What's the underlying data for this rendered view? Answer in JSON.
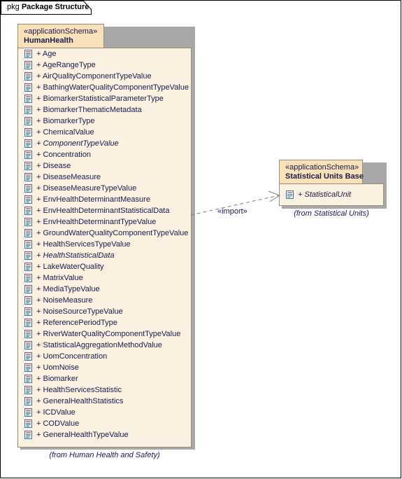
{
  "diagram": {
    "frame_keyword": "pkg",
    "frame_title": "Package Structure"
  },
  "packages": [
    {
      "id": "human-health",
      "stereotype": "«applicationSchema»",
      "name": "HumanHealth",
      "caption": "(from Human Health and Safety)",
      "classes": [
        {
          "visibility": "+",
          "name": "Age",
          "abstract": false
        },
        {
          "visibility": "+",
          "name": "AgeRangeType",
          "abstract": false
        },
        {
          "visibility": "+",
          "name": "AirQualityComponentTypeValue",
          "abstract": false
        },
        {
          "visibility": "+",
          "name": "BathingWaterQualityComponentTypeValue",
          "abstract": false
        },
        {
          "visibility": "+",
          "name": "BiomarkerStatisticalParameterType",
          "abstract": false
        },
        {
          "visibility": "+",
          "name": "BiomarkerThematicMetadata",
          "abstract": false
        },
        {
          "visibility": "+",
          "name": "BiomarkerType",
          "abstract": false
        },
        {
          "visibility": "+",
          "name": "ChemicalValue",
          "abstract": false
        },
        {
          "visibility": "+",
          "name": "ComponentTypeValue",
          "abstract": true
        },
        {
          "visibility": "+",
          "name": "Concentration",
          "abstract": false
        },
        {
          "visibility": "+",
          "name": "Disease",
          "abstract": false
        },
        {
          "visibility": "+",
          "name": "DiseaseMeasure",
          "abstract": false
        },
        {
          "visibility": "+",
          "name": "DiseaseMeasureTypeValue",
          "abstract": false
        },
        {
          "visibility": "+",
          "name": "EnvHealthDeterminantMeasure",
          "abstract": false
        },
        {
          "visibility": "+",
          "name": "EnvHealthDeterminantStatisticalData",
          "abstract": false
        },
        {
          "visibility": "+",
          "name": "EnvHealthDeterminantTypeValue",
          "abstract": false
        },
        {
          "visibility": "+",
          "name": "GroundWaterQualityComponentTypeValue",
          "abstract": false
        },
        {
          "visibility": "+",
          "name": "HealthServicesTypeValue",
          "abstract": false
        },
        {
          "visibility": "+",
          "name": "HealthStatisticalData",
          "abstract": true
        },
        {
          "visibility": "+",
          "name": "LakeWaterQuality",
          "abstract": false
        },
        {
          "visibility": "+",
          "name": "MatrixValue",
          "abstract": false
        },
        {
          "visibility": "+",
          "name": "MediaTypeValue",
          "abstract": false
        },
        {
          "visibility": "+",
          "name": "NoiseMeasure",
          "abstract": false
        },
        {
          "visibility": "+",
          "name": "NoiseSourceTypeValue",
          "abstract": false
        },
        {
          "visibility": "+",
          "name": "ReferencePeriodType",
          "abstract": false
        },
        {
          "visibility": "+",
          "name": "RiverWaterQualityComponentTypeValue",
          "abstract": false
        },
        {
          "visibility": "+",
          "name": "StatisticalAggregationMethodValue",
          "abstract": false
        },
        {
          "visibility": "+",
          "name": "UomConcentration",
          "abstract": false
        },
        {
          "visibility": "+",
          "name": "UomNoise",
          "abstract": false
        },
        {
          "visibility": "+",
          "name": "Biomarker",
          "abstract": false
        },
        {
          "visibility": "+",
          "name": "HealthServicesStatistic",
          "abstract": false
        },
        {
          "visibility": "+",
          "name": "GeneralHealthStatistics",
          "abstract": false
        },
        {
          "visibility": "+",
          "name": "ICDValue",
          "abstract": false
        },
        {
          "visibility": "+",
          "name": "CODValue",
          "abstract": false
        },
        {
          "visibility": "+",
          "name": "GeneralHealthTypeValue",
          "abstract": false
        }
      ]
    },
    {
      "id": "statistical-units-base",
      "stereotype": "«applicationSchema»",
      "name": "Statistical Units Base",
      "caption": "(from Statistical Units)",
      "classes": [
        {
          "visibility": "+",
          "name": "StatisticalUnit",
          "abstract": true
        }
      ]
    }
  ],
  "connectors": [
    {
      "id": "import-dependency",
      "label": "«import»",
      "style": "dashed-open-arrow",
      "source": "HumanHealth",
      "target": "Statistical Units Base"
    }
  ],
  "colors": {
    "package_tab_fill": "#f8e0b8",
    "package_body_fill": "#fbf1e0",
    "package_border": "#9a8e7a",
    "shadow": "#a8a8a8",
    "text": "#1a1a4e",
    "frame_border": "#000000",
    "connector": "#808080"
  }
}
